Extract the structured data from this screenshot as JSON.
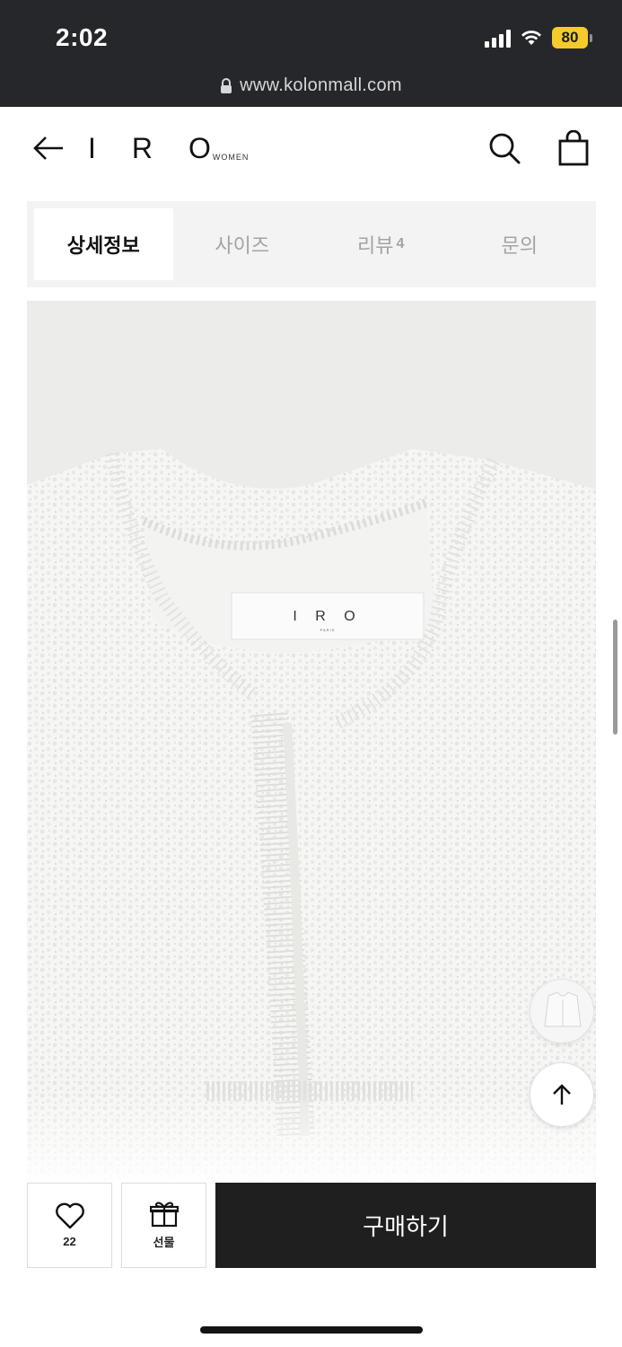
{
  "status_bar": {
    "time": "2:02",
    "battery": "80",
    "icons": [
      "signal-icon",
      "wifi-icon",
      "battery-icon"
    ],
    "url": "www.kolonmall.com"
  },
  "header": {
    "brand": "IRO",
    "brand_sub": "WOMEN",
    "icons": [
      "back-arrow-icon",
      "search-icon",
      "shopping-bag-icon"
    ]
  },
  "tabs": [
    {
      "label": "상세정보",
      "active": true
    },
    {
      "label": "사이즈",
      "active": false
    },
    {
      "label": "리뷰",
      "count": "4",
      "active": false
    },
    {
      "label": "문의",
      "active": false
    }
  ],
  "product_image": {
    "label_brand": "I R O",
    "label_sub": "PARIS"
  },
  "floating": {
    "icons": [
      "product-thumbnail",
      "arrow-up-icon"
    ]
  },
  "bottom_bar": {
    "like_count": "22",
    "gift_label": "선물",
    "buy_label": "구매하기",
    "icons": [
      "heart-icon",
      "gift-icon"
    ]
  }
}
